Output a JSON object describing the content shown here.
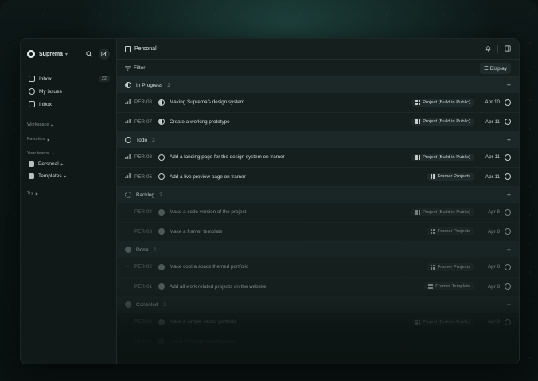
{
  "sidebar": {
    "workspace_name": "Suprema",
    "nav": [
      {
        "label": "Inbox",
        "count": "22"
      },
      {
        "label": "My issues"
      },
      {
        "label": "Inbox"
      }
    ],
    "sections": {
      "workspace": "Workspace",
      "favorites": "Favorites",
      "your_teams": "Your teams",
      "try": "Try"
    },
    "teams": [
      {
        "label": "Personal"
      },
      {
        "label": "Templates"
      }
    ]
  },
  "header": {
    "title": "Personal",
    "filter_label": "Filter",
    "display_label": "Display"
  },
  "groups": [
    {
      "name": "In Progress",
      "count": "2",
      "rows": [
        {
          "id": "PER-08",
          "title": "Making Suprema's design system",
          "tag": "Project (Build in Public)",
          "date": "Apr 10"
        },
        {
          "id": "PER-07",
          "title": "Create a working prototype",
          "tag": "Project (Build in Public)",
          "date": "Apr 11"
        }
      ]
    },
    {
      "name": "Todo",
      "count": "2",
      "rows": [
        {
          "id": "PER-08",
          "title": "Add a landing page for the design system on framer",
          "tag": "Project (Build in Public)",
          "date": "Apr 11"
        },
        {
          "id": "PER-05",
          "title": "Add a live preview page on framer",
          "tag": "Framer Projects",
          "date": "Apr 11"
        }
      ]
    },
    {
      "name": "Backlog",
      "count": "2",
      "rows": [
        {
          "id": "PER-04",
          "title": "Make a code version of the project",
          "tag": "Project (Build in Public)",
          "date": "Apr 8"
        },
        {
          "id": "PER-03",
          "title": "Make a framer template",
          "tag": "Framer Projects",
          "date": "Apr 8"
        }
      ]
    },
    {
      "name": "Done",
      "count": "2",
      "rows": [
        {
          "id": "PER-02",
          "title": "Make cool a space themed portfolio",
          "tag": "Framer Projects",
          "date": "Apr 8"
        },
        {
          "id": "PER-01",
          "title": "Add all work related projects on the website",
          "tag": "Framer Template",
          "date": "Apr 8"
        }
      ]
    },
    {
      "name": "Canceled",
      "count": "2",
      "rows": [
        {
          "id": "PER-02",
          "title": "Make a simple vector portfolio",
          "tag": "Project (Build in Public)",
          "date": "Apr 8"
        },
        {
          "id": "PER-01",
          "title": "Learn Webpage development",
          "tag": "",
          "date": ""
        }
      ]
    }
  ],
  "icons": {
    "search": "search-icon",
    "compose": "compose-icon",
    "bell": "bell-icon",
    "panel": "panel-icon"
  }
}
